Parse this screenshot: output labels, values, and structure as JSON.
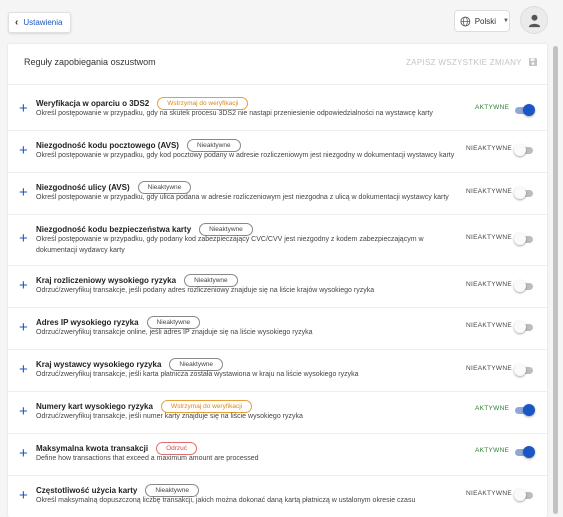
{
  "header": {
    "back_label": "Ustawienia",
    "language": "Polski"
  },
  "page": {
    "title": "Reguły zapobiegania oszustwom",
    "save_all_label": "ZAPISZ WSZYSTKIE ZMIANY"
  },
  "colors": {
    "accent": "#1a56c4",
    "active_text": "#2e7d32",
    "hold_badge": "#d88a1f",
    "reject_badge": "#d04a4a"
  },
  "rules": [
    {
      "title": "Weryfikacja w oparciu o 3DS2",
      "badge": "Wstrzymaj do weryfikacji",
      "badge_type": "hold",
      "description": "Określ postępowanie w przypadku, gdy na skutek procesu 3DS2 nie nastąpi przeniesienie odpowiedzialności na wystawcę karty",
      "status": "AKTYWNE",
      "enabled": true
    },
    {
      "title": "Niezgodność kodu pocztowego (AVS)",
      "badge": "Nieaktywne",
      "badge_type": "inactive",
      "description": "Określ postępowanie w przypadku, gdy kod pocztowy podany w adresie rozliczeniowym jest niezgodny w dokumentacji wystawcy karty",
      "status": "NIEAKTYWNE",
      "enabled": false
    },
    {
      "title": "Niezgodność ulicy (AVS)",
      "badge": "Nieaktywne",
      "badge_type": "inactive",
      "description": "Określ postępowanie w przypadku, gdy ulica podana w adresie rozliczeniowym jest niezgodna z ulicą w dokumentacji wystawcy karty",
      "status": "NIEAKTYWNE",
      "enabled": false
    },
    {
      "title": "Niezgodność kodu bezpieczeństwa karty",
      "badge": "Nieaktywne",
      "badge_type": "inactive",
      "description": "Określ postępowanie w przypadku, gdy podany kod zabezpieczający CVC/CVV jest niezgodny z kodem zabezpieczającym w dokumentacji wydawcy karty",
      "status": "NIEAKTYWNE",
      "enabled": false
    },
    {
      "title": "Kraj rozliczeniowy wysokiego ryzyka",
      "badge": "Nieaktywne",
      "badge_type": "inactive",
      "description": "Odrzuć/zweryfikuj transakcje, jeśli podany adres rozliczeniowy znajduje się na liście krajów wysokiego ryzyka",
      "status": "NIEAKTYWNE",
      "enabled": false
    },
    {
      "title": "Adres IP wysokiego ryzyka",
      "badge": "Nieaktywne",
      "badge_type": "inactive",
      "description": "Odrzuć/zweryfikuj transakcje online, jeśli adres IP znajduje się na liście wysokiego ryzyka",
      "status": "NIEAKTYWNE",
      "enabled": false
    },
    {
      "title": "Kraj wystawcy wysokiego ryzyka",
      "badge": "Nieaktywne",
      "badge_type": "inactive",
      "description": "Odrzuć/zweryfikuj transakcje, jeśli karta płatnicza została wystawiona w kraju na liście wysokiego ryzyka",
      "status": "NIEAKTYWNE",
      "enabled": false
    },
    {
      "title": "Numery kart wysokiego ryzyka",
      "badge": "Wstrzymaj do weryfikacji",
      "badge_type": "hold",
      "description": "Odrzuć/zweryfikuj transakcje, jeśli numer karty znajduje się na liście wysokiego ryzyka",
      "status": "AKTYWNE",
      "enabled": true
    },
    {
      "title": "Maksymalna kwota transakcji",
      "badge": "Odrzuć",
      "badge_type": "reject",
      "description": "Define how transactions that exceed a maximum amount are processed",
      "status": "AKTYWNE",
      "enabled": true
    },
    {
      "title": "Częstotliwość użycia karty",
      "badge": "Nieaktywne",
      "badge_type": "inactive",
      "description": "Określ maksymalną dopuszczoną liczbę transakcji, jakich można dokonać daną kartą płatniczą w ustalonym okresie czasu",
      "status": "NIEAKTYWNE",
      "enabled": false
    }
  ]
}
